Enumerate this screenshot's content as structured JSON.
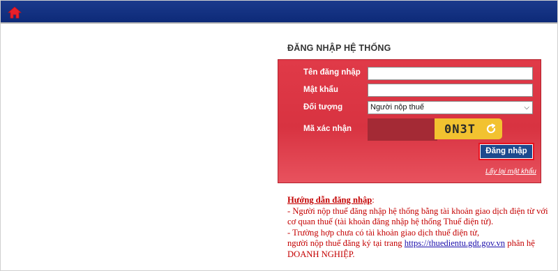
{
  "header": {
    "home_icon": "home-icon",
    "bar_color": "#0d2a78"
  },
  "login": {
    "title": "ĐĂNG NHẬP HỆ THỐNG",
    "box_color": "#d83341",
    "fields": {
      "username_label": "Tên đăng nhập",
      "username_value": "",
      "password_label": "Mật khẩu",
      "password_value": "",
      "role_label": "Đối tượng",
      "role_selected": "Người nộp thuế",
      "captcha_label": "Mã xác nhận",
      "captcha_value": "",
      "captcha_text": "0N3T"
    },
    "submit_label": "Đăng nhập",
    "forgot_label": "Lấy lại mật khẩu"
  },
  "guide": {
    "heading": "Hướng dẫn đăng nhập",
    "line1": "- Người nộp thuế đăng nhập hệ thống bằng tài khoản giao dịch điện từ với cơ quan thuế (tài khoản đăng nhập hệ thống Thuế điện tử).",
    "line2": "- Trường hợp chưa có tài khoản giao dịch thuế điện tử,",
    "line3_prefix": "người nộp thuế đăng ký tại trang",
    "link": "https://thuedientu.gdt.gov.vn",
    "line3_suffix": "phân hệ DOANH NGHIỆP."
  }
}
